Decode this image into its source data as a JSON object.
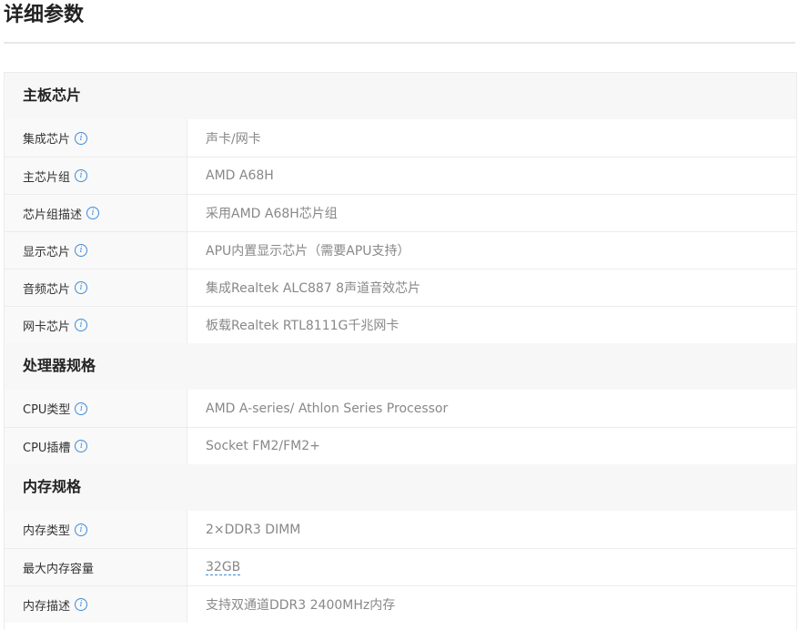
{
  "page": {
    "title": "详细参数"
  },
  "sections": [
    {
      "title": "主板芯片",
      "rows": [
        {
          "label": "集成芯片",
          "value": "声卡/网卡",
          "info": true
        },
        {
          "label": "主芯片组",
          "value": "AMD A68H",
          "info": true
        },
        {
          "label": "芯片组描述",
          "value": "采用AMD A68H芯片组",
          "info": true
        },
        {
          "label": "显示芯片",
          "value": "APU内置显示芯片（需要APU支持）",
          "info": true
        },
        {
          "label": "音频芯片",
          "value": "集成Realtek ALC887 8声道音效芯片",
          "info": true
        },
        {
          "label": "网卡芯片",
          "value": "板载Realtek RTL8111G千兆网卡",
          "info": true
        }
      ]
    },
    {
      "title": "处理器规格",
      "rows": [
        {
          "label": "CPU类型",
          "value": "AMD A-series/ Athlon Series Processor",
          "info": true
        },
        {
          "label": "CPU插槽",
          "value": "Socket FM2/FM2+",
          "info": true
        }
      ]
    },
    {
      "title": "内存规格",
      "rows": [
        {
          "label": "内存类型",
          "value": "2×DDR3 DIMM",
          "info": true
        },
        {
          "label": "最大内存容量",
          "value": "32GB",
          "info": false,
          "link": true
        },
        {
          "label": "内存描述",
          "value": "支持双通道DDR3 2400MHz内存",
          "info": true
        }
      ]
    }
  ],
  "icons": {
    "info": "info-circle-icon"
  },
  "colors": {
    "info_icon": "#3f8bd9",
    "header_bg": "#f7f7f7",
    "border": "#ececec"
  }
}
